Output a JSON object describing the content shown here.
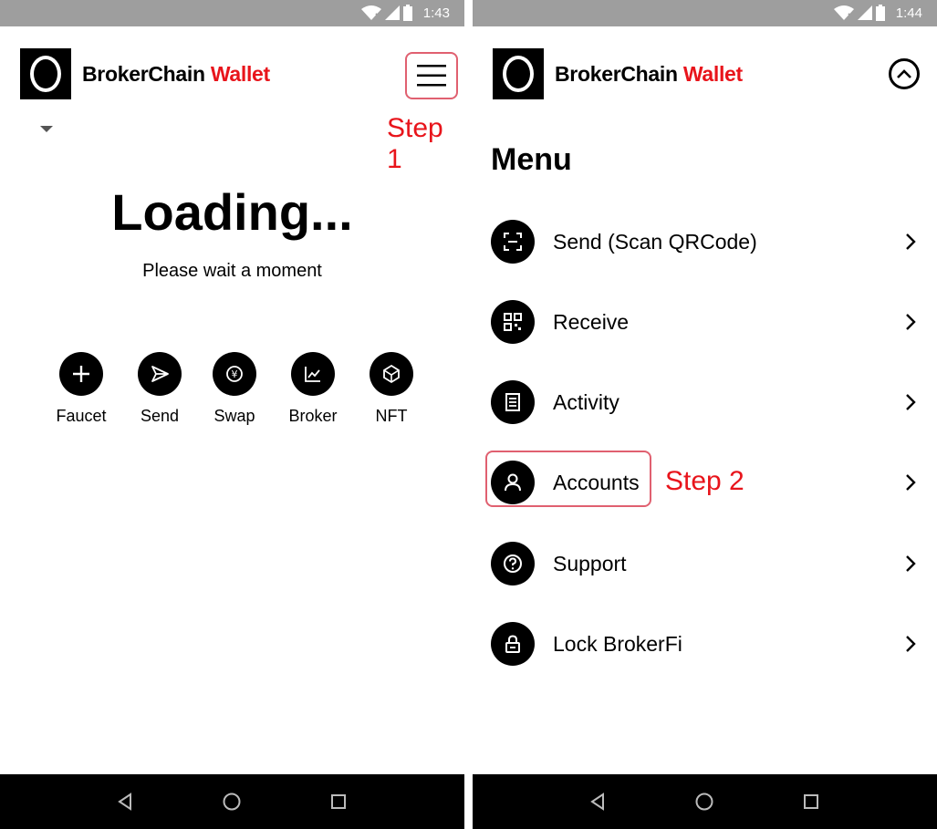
{
  "left": {
    "status": {
      "time": "1:43"
    },
    "brand": {
      "name": "BrokerChain",
      "accent": "Wallet"
    },
    "annotation": "Step 1",
    "loading": {
      "title": "Loading...",
      "subtitle": "Please wait a moment"
    },
    "actions": [
      {
        "label": "Faucet",
        "icon": "plus-icon"
      },
      {
        "label": "Send",
        "icon": "send-icon"
      },
      {
        "label": "Swap",
        "icon": "swap-icon"
      },
      {
        "label": "Broker",
        "icon": "chart-icon"
      },
      {
        "label": "NFT",
        "icon": "nft-icon"
      }
    ]
  },
  "right": {
    "status": {
      "time": "1:44"
    },
    "brand": {
      "name": "BrokerChain",
      "accent": "Wallet"
    },
    "menu_title": "Menu",
    "annotation": "Step 2",
    "menu": [
      {
        "label": "Send (Scan QRCode)",
        "icon": "scan-icon"
      },
      {
        "label": "Receive",
        "icon": "qrcode-icon"
      },
      {
        "label": "Activity",
        "icon": "list-icon"
      },
      {
        "label": "Accounts",
        "icon": "user-icon"
      },
      {
        "label": "Support",
        "icon": "help-icon"
      },
      {
        "label": "Lock BrokerFi",
        "icon": "lock-icon"
      }
    ]
  },
  "colors": {
    "accent": "#e8141b",
    "highlight": "#e06070",
    "status_bar": "#9e9e9e",
    "nav_bar": "#000000"
  }
}
